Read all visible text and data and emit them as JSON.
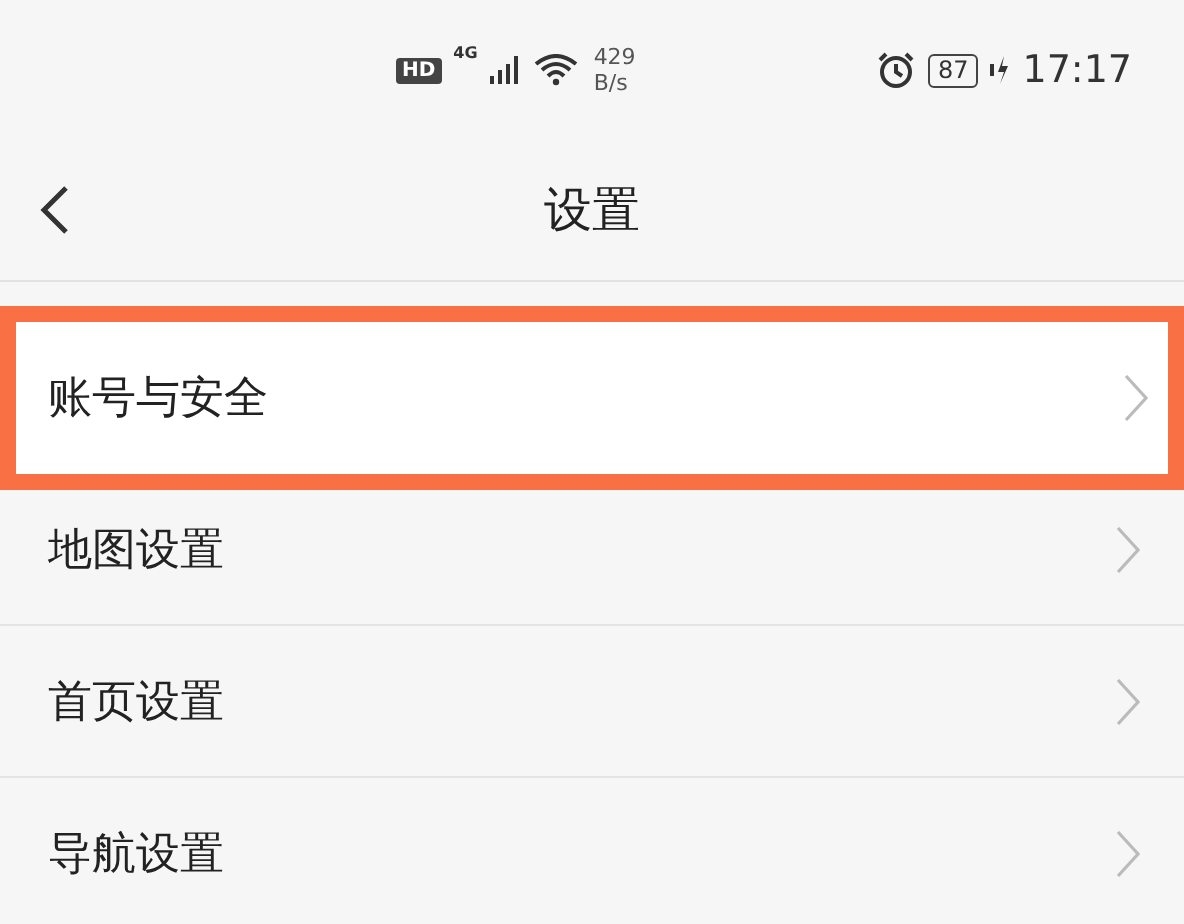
{
  "status_bar": {
    "hd": "HD",
    "network": "4G",
    "speed_value": "429",
    "speed_unit": "B/s",
    "battery": "87",
    "time": "17:17"
  },
  "header": {
    "title": "设置"
  },
  "items": [
    {
      "label": "账号与安全",
      "highlighted": true
    },
    {
      "label": "地图设置",
      "highlighted": false
    },
    {
      "label": "首页设置",
      "highlighted": false
    },
    {
      "label": "导航设置",
      "highlighted": false
    }
  ]
}
